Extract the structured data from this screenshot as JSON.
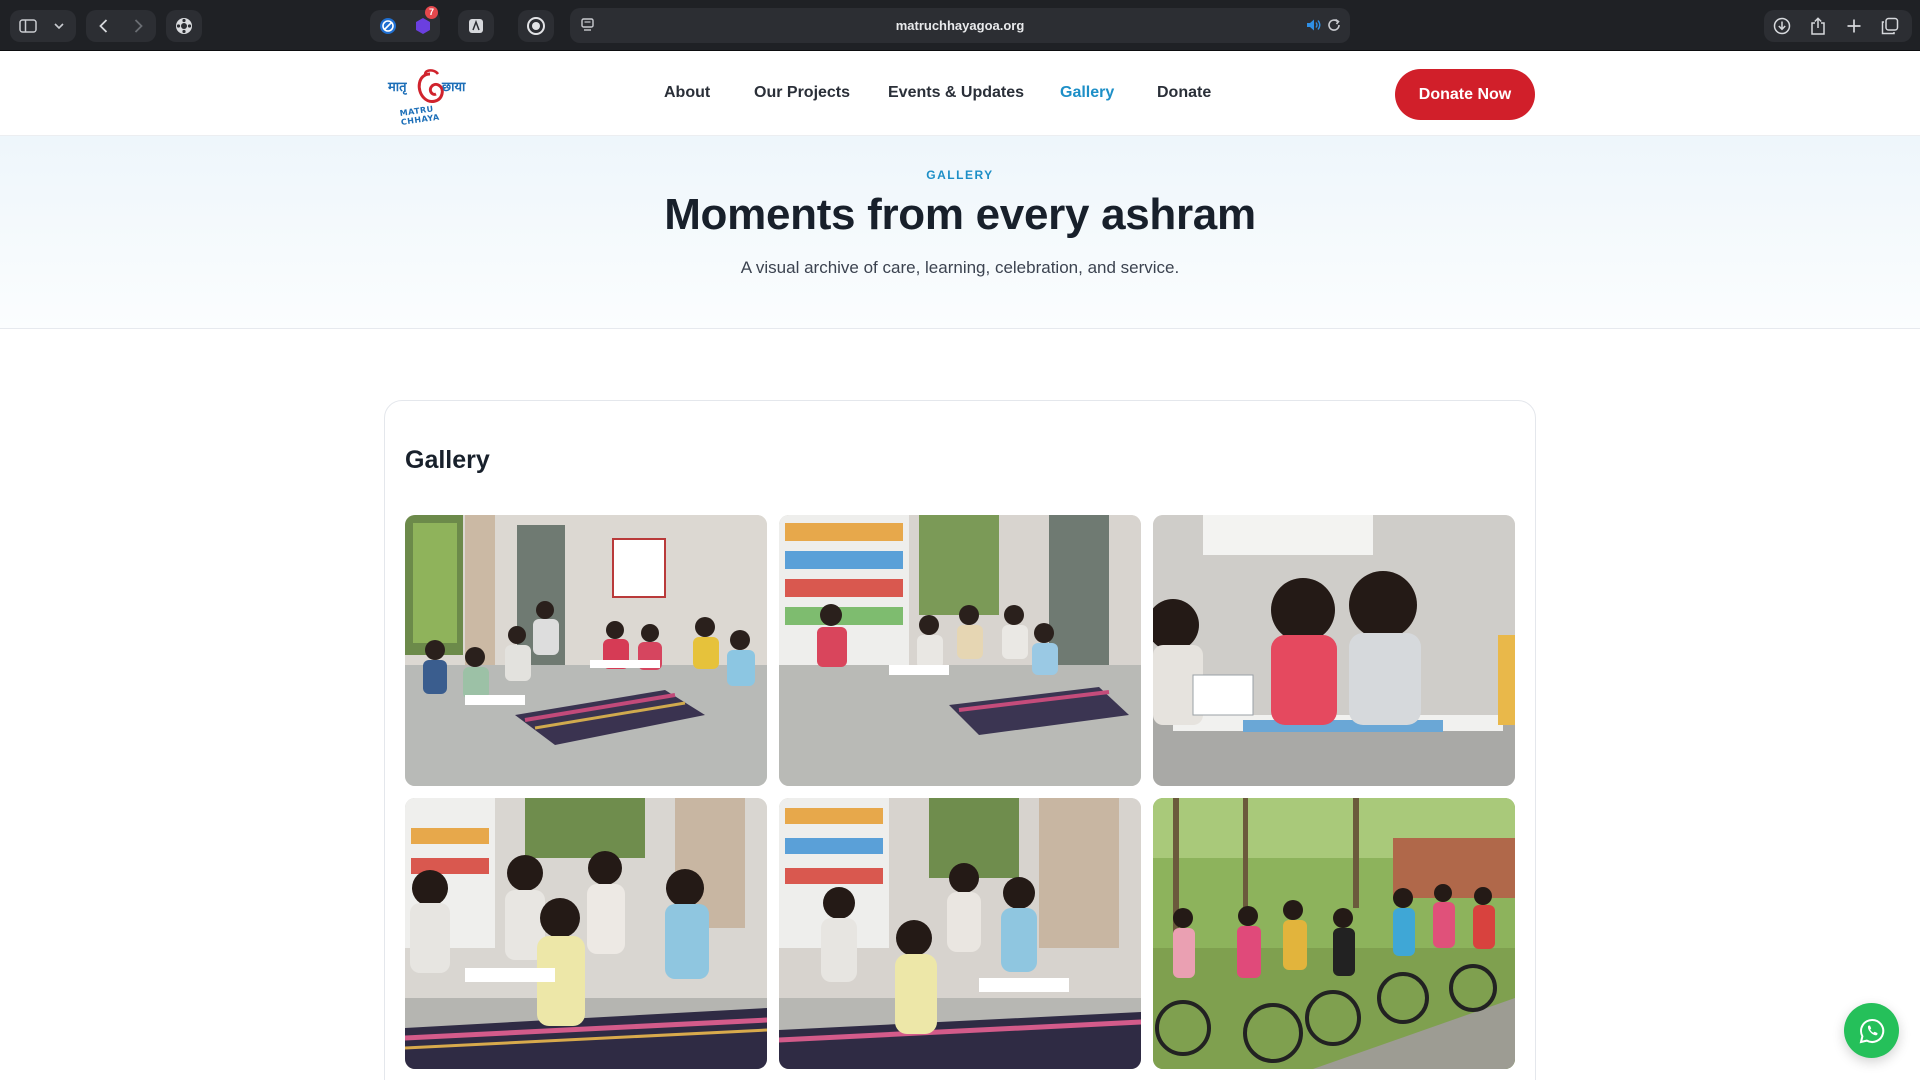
{
  "browser": {
    "url": "matruchhayagoa.org",
    "extension_badge": "7"
  },
  "site": {
    "logo_text_left": "मातृ",
    "logo_text_right": "छाया",
    "logo_text_bottom": "MATRU CHHAYA",
    "nav": {
      "about": "About",
      "projects": "Our Projects",
      "events": "Events & Updates",
      "gallery": "Gallery",
      "donate": "Donate"
    },
    "donate_now": "Donate Now"
  },
  "hero": {
    "eyebrow": "GALLERY",
    "title": "Moments from every ashram",
    "subtitle": "A visual archive of care, learning, celebration, and service."
  },
  "gallery": {
    "heading": "Gallery",
    "photos": [
      "Girls studying on the floor in a classroom",
      "Girls reading near a bookshelf",
      "Two girls writing together at a low desk",
      "Girls studying on a striped mat",
      "Group study session beside bookshelf",
      "Girls riding bicycles outdoors"
    ]
  },
  "colors": {
    "accent": "#1d8fc7",
    "donate": "#d11f2a",
    "whatsapp": "#25c05a"
  },
  "icons": [
    "sidebar-icon",
    "chevron-down-icon",
    "back-icon",
    "forward-icon",
    "extension-icon",
    "share-icon",
    "plus-icon",
    "tabs-icon",
    "download-icon",
    "reload-icon",
    "audio-icon",
    "whatsapp-icon"
  ]
}
